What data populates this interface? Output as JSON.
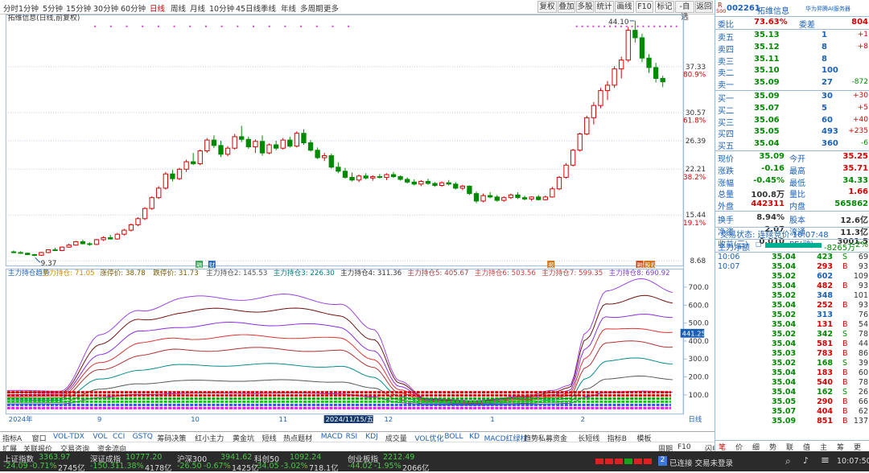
{
  "toolbar": {
    "periods": [
      "分时",
      "1分钟",
      "5分钟",
      "15分钟",
      "30分钟",
      "60分钟",
      "日线",
      "周线",
      "月线",
      "10分钟",
      "45日线",
      "季线",
      "年线",
      "多周期",
      "更多"
    ],
    "active_period": "日线",
    "buttons": [
      "复权",
      "叠加",
      "多股",
      "统计",
      "画线",
      "F10",
      "标记",
      "-自选",
      "返回"
    ]
  },
  "chart": {
    "title": "拓维信息(日线,前复权)",
    "indicator_line": [
      "主力持仓趋势",
      "主力持仓: 71.05",
      "涨停价: 38.78",
      "跌停价: 31.73",
      "主力持仓2: 145.53",
      "主力持仓3: 226.30",
      "主力持仓4: 311.36",
      "主力持仓5: 405.67",
      "主力持仓6: 503.56",
      "主力持仓7: 599.35",
      "主力持仓8: 690.92"
    ],
    "price_labels": [
      {
        "value": "37.33",
        "pct": "80.9%"
      },
      {
        "value": "30.57",
        "pct": "61.8%"
      },
      {
        "value": "26.39",
        "pct": ""
      },
      {
        "value": "22.21",
        "pct": "38.2%"
      },
      {
        "value": "15.44",
        "pct": "19.1%"
      },
      {
        "value": "8.68",
        "pct": ""
      }
    ],
    "high_label": "44.10",
    "low_label": "9.37",
    "ind_labels": [
      "700.0",
      "600.0",
      "500.0",
      "400.0",
      "300.0",
      "200.0",
      "100.0"
    ],
    "ind_marker": "441.25",
    "date_labels": [
      "2024年",
      "9",
      "10",
      "11",
      "2024/11/15/五",
      "12",
      "1",
      "2"
    ],
    "period_tag": "日线",
    "markers": {
      "m1": "融",
      "m2": "财",
      "m3": "报",
      "m4": "融",
      "m5": "股权"
    },
    "colors": {
      "up": "#d20000",
      "down": "#008a00",
      "bg": "#ffffff",
      "grid": "#b8c8d8"
    }
  },
  "chart_data": {
    "type": "candlestick",
    "title": "拓维信息(日线,前复权)",
    "ylim": [
      8.68,
      44.1
    ],
    "x_labels": [
      "2024年",
      "9",
      "10",
      "11",
      "12",
      "1",
      "2"
    ],
    "candles": [
      [
        10.0,
        10.2,
        9.8,
        9.9
      ],
      [
        9.9,
        10.1,
        9.7,
        9.8
      ],
      [
        9.8,
        9.9,
        9.5,
        9.6
      ],
      [
        9.6,
        9.7,
        9.37,
        9.5
      ],
      [
        9.5,
        10.0,
        9.4,
        9.9
      ],
      [
        9.9,
        10.4,
        9.8,
        10.3
      ],
      [
        10.3,
        10.6,
        10.1,
        10.2
      ],
      [
        10.2,
        10.8,
        10.1,
        10.7
      ],
      [
        10.7,
        11.2,
        10.6,
        11.0
      ],
      [
        11.0,
        11.6,
        10.9,
        11.5
      ],
      [
        11.5,
        11.8,
        11.1,
        11.2
      ],
      [
        11.2,
        11.4,
        10.9,
        11.1
      ],
      [
        11.1,
        11.9,
        11.0,
        11.8
      ],
      [
        11.8,
        12.3,
        11.6,
        12.1
      ],
      [
        12.1,
        12.5,
        11.8,
        11.9
      ],
      [
        11.9,
        12.8,
        11.8,
        12.6
      ],
      [
        12.6,
        13.4,
        12.4,
        13.2
      ],
      [
        13.2,
        14.2,
        13.0,
        14.0
      ],
      [
        14.0,
        15.1,
        13.8,
        14.9
      ],
      [
        14.9,
        16.6,
        14.7,
        16.4
      ],
      [
        16.4,
        18.2,
        16.2,
        18.0
      ],
      [
        18.0,
        19.7,
        17.8,
        19.4
      ],
      [
        19.4,
        21.8,
        19.2,
        21.5
      ],
      [
        21.5,
        22.1,
        20.4,
        20.8
      ],
      [
        20.8,
        22.4,
        20.6,
        22.2
      ],
      [
        22.2,
        23.6,
        21.8,
        23.3
      ],
      [
        23.3,
        24.6,
        22.8,
        23.0
      ],
      [
        23.0,
        25.1,
        22.8,
        24.9
      ],
      [
        24.9,
        26.8,
        24.6,
        26.5
      ],
      [
        26.5,
        27.2,
        25.3,
        25.7
      ],
      [
        25.7,
        26.4,
        24.0,
        24.4
      ],
      [
        24.4,
        25.6,
        24.1,
        25.3
      ],
      [
        25.3,
        27.4,
        25.1,
        27.0
      ],
      [
        27.0,
        28.6,
        26.2,
        26.6
      ],
      [
        26.6,
        27.0,
        25.2,
        25.5
      ],
      [
        25.5,
        26.6,
        24.6,
        26.3
      ],
      [
        26.3,
        27.2,
        24.2,
        24.6
      ],
      [
        24.6,
        26.0,
        24.4,
        25.8
      ],
      [
        25.8,
        26.4,
        25.0,
        25.3
      ],
      [
        25.3,
        26.8,
        25.1,
        26.5
      ],
      [
        26.5,
        27.0,
        25.4,
        25.6
      ],
      [
        25.6,
        27.8,
        25.4,
        27.5
      ],
      [
        27.5,
        28.1,
        25.8,
        26.1
      ],
      [
        26.1,
        26.5,
        24.8,
        25.0
      ],
      [
        25.0,
        25.4,
        23.7,
        23.9
      ],
      [
        23.9,
        24.6,
        23.4,
        24.2
      ],
      [
        24.2,
        24.5,
        22.3,
        22.5
      ],
      [
        22.5,
        23.2,
        21.6,
        21.9
      ],
      [
        21.9,
        22.4,
        20.8,
        21.0
      ],
      [
        21.0,
        21.7,
        20.4,
        20.6
      ],
      [
        20.6,
        21.4,
        20.3,
        21.2
      ],
      [
        21.2,
        21.6,
        20.7,
        20.9
      ],
      [
        20.9,
        21.3,
        20.5,
        21.1
      ],
      [
        21.1,
        21.5,
        20.8,
        21.0
      ],
      [
        21.0,
        21.6,
        20.6,
        21.4
      ],
      [
        21.4,
        21.8,
        20.9,
        21.1
      ],
      [
        21.1,
        21.3,
        20.5,
        20.7
      ],
      [
        20.7,
        21.0,
        20.1,
        20.3
      ],
      [
        20.3,
        20.7,
        19.8,
        20.0
      ],
      [
        20.0,
        20.6,
        19.7,
        20.4
      ],
      [
        20.4,
        20.8,
        19.9,
        20.1
      ],
      [
        20.1,
        20.3,
        19.6,
        19.8
      ],
      [
        19.8,
        20.4,
        19.6,
        20.2
      ],
      [
        20.2,
        20.6,
        19.8,
        20.0
      ],
      [
        20.0,
        20.3,
        19.2,
        19.4
      ],
      [
        19.4,
        19.9,
        19.1,
        19.7
      ],
      [
        19.7,
        19.8,
        18.4,
        18.6
      ],
      [
        18.6,
        18.9,
        17.2,
        17.5
      ],
      [
        17.5,
        18.6,
        17.3,
        18.3
      ],
      [
        18.3,
        18.8,
        17.9,
        18.1
      ],
      [
        18.1,
        18.4,
        17.4,
        17.6
      ],
      [
        17.6,
        18.2,
        17.4,
        18.0
      ],
      [
        18.0,
        18.6,
        17.8,
        18.4
      ],
      [
        18.4,
        18.8,
        17.8,
        18.0
      ],
      [
        18.0,
        18.3,
        17.6,
        17.8
      ],
      [
        17.8,
        18.2,
        17.5,
        18.1
      ],
      [
        18.1,
        18.4,
        17.6,
        17.7
      ],
      [
        17.7,
        18.3,
        17.6,
        18.1
      ],
      [
        18.1,
        19.6,
        18.0,
        19.3
      ],
      [
        19.3,
        21.2,
        19.1,
        21.0
      ],
      [
        21.0,
        23.1,
        20.8,
        22.8
      ],
      [
        22.8,
        25.2,
        22.6,
        25.0
      ],
      [
        25.0,
        27.6,
        24.8,
        27.4
      ],
      [
        27.4,
        30.1,
        27.2,
        29.8
      ],
      [
        29.8,
        32.1,
        28.8,
        31.6
      ],
      [
        31.6,
        34.2,
        31.2,
        33.8
      ],
      [
        33.8,
        35.2,
        32.4,
        34.6
      ],
      [
        34.6,
        37.4,
        34.2,
        37.0
      ],
      [
        37.0,
        38.8,
        35.6,
        38.3
      ],
      [
        38.3,
        43.2,
        38.0,
        42.7
      ],
      [
        42.7,
        44.1,
        40.9,
        41.6
      ],
      [
        41.6,
        42.2,
        38.0,
        38.6
      ],
      [
        38.6,
        39.2,
        36.4,
        37.2
      ],
      [
        37.2,
        37.9,
        35.0,
        35.6
      ],
      [
        35.6,
        36.0,
        34.3,
        35.09
      ]
    ],
    "indicator": {
      "name": "主力持仓趋势",
      "ylim": [
        0,
        750
      ],
      "series_last": [
        {
          "name": "主力持仓",
          "value": 71.05
        },
        {
          "name": "主力持仓2",
          "value": 145.53
        },
        {
          "name": "主力持仓3",
          "value": 226.3
        },
        {
          "name": "主力持仓4",
          "value": 311.36
        },
        {
          "name": "主力持仓5",
          "value": 405.67
        },
        {
          "name": "主力持仓6",
          "value": 503.56
        },
        {
          "name": "主力持仓7",
          "value": 599.35
        },
        {
          "name": "主力持仓8",
          "value": 690.92
        }
      ]
    }
  },
  "quote": {
    "code": "002261",
    "name": "拓维信息",
    "tag": "华为昇腾AI服务器",
    "r_label": "R",
    "r_sub": "500",
    "webi_label": "委比",
    "webi": "73.63%",
    "weicha_label": "委差",
    "weicha": "804",
    "asks": [
      {
        "label": "卖五",
        "price": "35.13",
        "vol": "1",
        "chg": "+1"
      },
      {
        "label": "卖四",
        "price": "35.12",
        "vol": "8",
        "chg": "+8"
      },
      {
        "label": "卖三",
        "price": "35.11",
        "vol": "8",
        "chg": ""
      },
      {
        "label": "卖二",
        "price": "35.10",
        "vol": "100",
        "chg": ""
      },
      {
        "label": "卖一",
        "price": "35.09",
        "vol": "27",
        "chg": "-872"
      }
    ],
    "bids": [
      {
        "label": "买一",
        "price": "35.09",
        "vol": "30",
        "chg": "+30"
      },
      {
        "label": "买二",
        "price": "35.07",
        "vol": "5",
        "chg": "+5"
      },
      {
        "label": "买三",
        "price": "35.06",
        "vol": "60",
        "chg": "+40"
      },
      {
        "label": "买四",
        "price": "35.05",
        "vol": "493",
        "chg": "+235"
      },
      {
        "label": "买五",
        "price": "35.04",
        "vol": "360",
        "chg": "-6"
      }
    ],
    "stats": [
      {
        "l1": "现价",
        "v1": "35.09",
        "l2": "今开",
        "v2": "35.25",
        "c1": "green",
        "c2": "red"
      },
      {
        "l1": "涨跌",
        "v1": "-0.16",
        "l2": "最高",
        "v2": "35.71",
        "c1": "green",
        "c2": "red"
      },
      {
        "l1": "涨幅",
        "v1": "-0.45%",
        "l2": "最低",
        "v2": "34.33",
        "c1": "green",
        "c2": "green"
      },
      {
        "l1": "总量",
        "v1": "100.8万",
        "l2": "量比",
        "v2": "1.66",
        "c1": "black",
        "c2": "red"
      },
      {
        "l1": "外盘",
        "v1": "442311",
        "l2": "内盘",
        "v2": "565862",
        "c1": "red",
        "c2": "green"
      },
      {
        "l1": "换手",
        "v1": "8.94%",
        "l2": "股本",
        "v2": "12.6亿",
        "c1": "black",
        "c2": "black"
      },
      {
        "l1": "净资",
        "v1": "2.07",
        "l2": "流通",
        "v2": "11.3亿",
        "c1": "black",
        "c2": "black"
      },
      {
        "l1": "收益(三)",
        "v1": "0.010",
        "l2": "PE(动)",
        "v2": "3001.5",
        "c1": "black",
        "c2": "black"
      }
    ],
    "trade_status": "交易状态: 连续竞价 10:07:48",
    "net_label": "主力净额",
    "net_value": "-8265万",
    "net_pct": "-2%",
    "ticks": [
      {
        "time": "10:06",
        "price": "35.04",
        "vol": "423",
        "side": "S",
        "n": "69"
      },
      {
        "time": "10:07",
        "price": "35.04",
        "vol": "293",
        "side": "B",
        "n": "93"
      },
      {
        "time": "",
        "price": "35.02",
        "vol": "602",
        "side": "",
        "n": "109"
      },
      {
        "time": "",
        "price": "35.04",
        "vol": "482",
        "side": "B",
        "n": "93"
      },
      {
        "time": "",
        "price": "35.02",
        "vol": "348",
        "side": "",
        "n": "101"
      },
      {
        "time": "",
        "price": "35.04",
        "vol": "252",
        "side": "B",
        "n": "93"
      },
      {
        "time": "",
        "price": "35.02",
        "vol": "313",
        "side": "",
        "n": "76"
      },
      {
        "time": "",
        "price": "35.04",
        "vol": "131",
        "side": "B",
        "n": "54"
      },
      {
        "time": "",
        "price": "35.02",
        "vol": "342",
        "side": "S",
        "n": "78"
      },
      {
        "time": "",
        "price": "35.04",
        "vol": "581",
        "side": "B",
        "n": "44"
      },
      {
        "time": "",
        "price": "35.03",
        "vol": "783",
        "side": "B",
        "n": "86"
      },
      {
        "time": "",
        "price": "35.02",
        "vol": "168",
        "side": "S",
        "n": "39"
      },
      {
        "time": "",
        "price": "35.04",
        "vol": "183",
        "side": "B",
        "n": "60"
      },
      {
        "time": "",
        "price": "35.04",
        "vol": "540",
        "side": "B",
        "n": "78"
      },
      {
        "time": "",
        "price": "35.04",
        "vol": "162",
        "side": "S",
        "n": "26"
      },
      {
        "time": "",
        "price": "35.05",
        "vol": "290",
        "side": "B",
        "n": "66"
      },
      {
        "time": "",
        "price": "35.07",
        "vol": "404",
        "side": "B",
        "n": "62"
      },
      {
        "time": "",
        "price": "35.09",
        "vol": "851",
        "side": "B",
        "n": "137"
      }
    ],
    "bottom_tabs": [
      "笔",
      "价",
      "细",
      "势",
      "联",
      "值",
      "主",
      "筹",
      "更"
    ]
  },
  "tabs_row1": [
    "指标A",
    "窗口",
    "VOL-TDX",
    "VOL",
    "CCI",
    "GSTQ",
    "筹码决策",
    "红小主力",
    "黄金坑",
    "短线",
    "热点题材",
    "MACD",
    "RSI",
    "KDJ",
    "成交量",
    "VOL优化",
    "BOLL",
    "KD",
    "MACD红绿柱",
    "趋势私募资金",
    "长短线",
    "指标B",
    "模板"
  ],
  "tabs_row2": [
    "扩展",
    "关联报价",
    "交易咨询",
    "资金流向"
  ],
  "right_tabs": [
    "周期",
    "F10",
    "闪电手"
  ],
  "status": {
    "indices": [
      {
        "name": "上证指数",
        "value": "3363.97",
        "chg": "-24.09",
        "pct": "-0.71%",
        "amt": "2745亿"
      },
      {
        "name": "深证成指",
        "value": "10777.20",
        "chg": "-150.31",
        "pct": "-1.38%",
        "amt": "4178亿"
      },
      {
        "name": "沪深300",
        "value": "3941.62",
        "chg": "-26.50",
        "pct": "-0.67%",
        "amt": "1425亿"
      },
      {
        "name": "科创50",
        "value": "1092.24",
        "chg": "-34.05",
        "pct": "-3.02%",
        "amt": "718.1亿"
      },
      {
        "name": "创业板指",
        "value": "2212.49",
        "chg": "-44.02",
        "pct": "-1.95%",
        "amt": "2066亿"
      }
    ],
    "connection": "已连接 交易未登录",
    "conn_badge": "2",
    "clock": "10:07:50"
  }
}
